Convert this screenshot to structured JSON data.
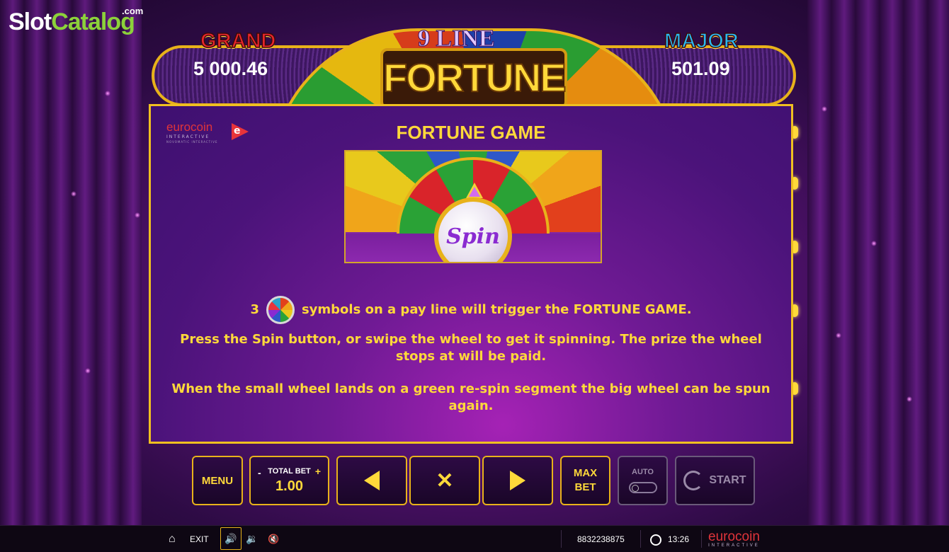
{
  "watermark": {
    "part1": "Slot",
    "part2": "Catalog",
    "suffix": ".com"
  },
  "jackpots": {
    "grand": {
      "label": "GRAND",
      "value": "5 000.46"
    },
    "major": {
      "label": "MAJOR",
      "value": "501.09"
    }
  },
  "game_title": {
    "line1": "9 LINE",
    "line2": "FORTUNE"
  },
  "panel": {
    "brand_name": "eurocoin",
    "brand_sub": "INTERACTIVE",
    "brand_sub2": "NOVOMATIC INTERACTIVE",
    "title": "FORTUNE GAME",
    "spin_label": "Spin",
    "line1_count": "3",
    "line1_text": "symbols on a pay line will trigger the FORTUNE GAME.",
    "line2": "Press the Spin button, or swipe the wheel to get it spinning. The prize the wheel stops at will be paid.",
    "line3": "When the small wheel lands on a green re-spin segment the big wheel can be spun again."
  },
  "controls": {
    "menu": "MENU",
    "total_bet_label": "TOTAL BET",
    "total_bet_minus": "-",
    "total_bet_plus": "+",
    "total_bet_value": "1.00",
    "close": "✕",
    "max_bet_line1": "MAX",
    "max_bet_line2": "BET",
    "auto": "AUTO",
    "start": "START"
  },
  "bottom_bar": {
    "exit": "EXIT",
    "session_id": "8832238875",
    "time": "13:26",
    "brand_name": "eurocoin",
    "brand_sub": "INTERACTIVE"
  },
  "colors": {
    "accent": "#ffd93a",
    "frame": "#e8b21a",
    "brand_red": "#e0343a"
  }
}
